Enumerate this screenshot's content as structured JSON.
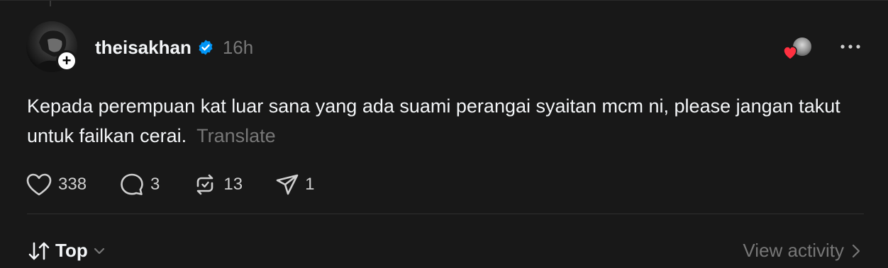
{
  "post": {
    "username": "theisakhan",
    "time": "16h",
    "text": "Kepada perempuan kat luar sana yang ada suami perangai syaitan mcm ni, please jangan takut untuk failkan cerai.",
    "translate_label": "Translate",
    "verified_icon": "verified-badge-icon",
    "follow_icon": "plus-icon",
    "more_icon": "more-horizontal-icon"
  },
  "actions": {
    "likes": "338",
    "replies": "3",
    "reposts": "13",
    "shares": "1"
  },
  "footer": {
    "sort_label": "Top",
    "view_activity_label": "View activity"
  },
  "colors": {
    "background": "#181818",
    "text": "#f3f5f7",
    "muted": "#777777",
    "verified": "#0095f6",
    "heart": "#ff3040"
  }
}
